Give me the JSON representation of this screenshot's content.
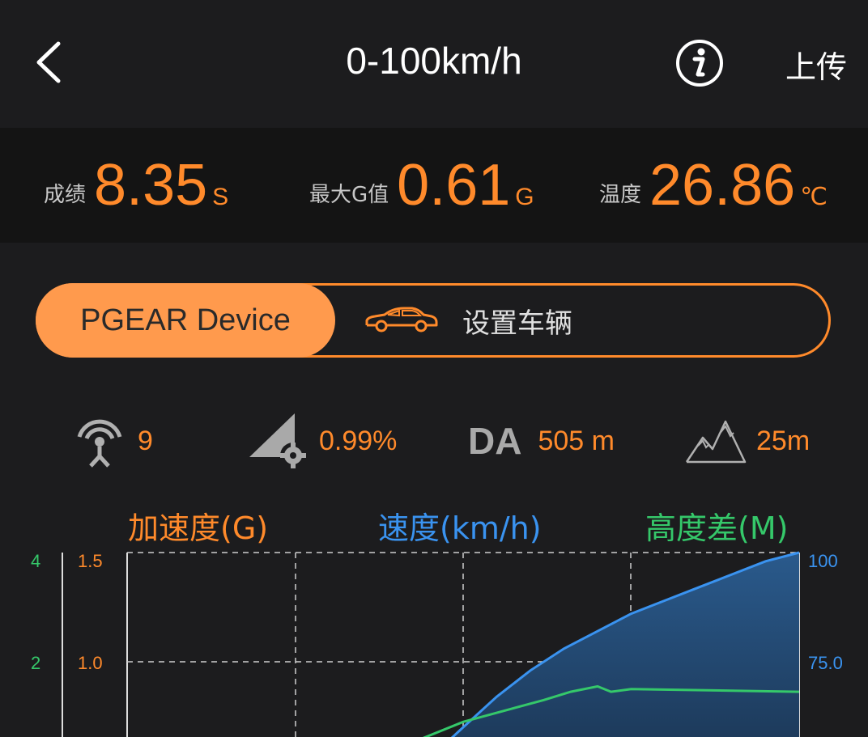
{
  "header": {
    "title": "0-100km/h",
    "upload_label": "上传"
  },
  "stats": {
    "score": {
      "label": "成绩",
      "value": "8.35",
      "unit": "S"
    },
    "max_g": {
      "label": "最大G值",
      "value": "0.61",
      "unit": "G"
    },
    "temperature": {
      "label": "温度",
      "value": "26.86",
      "unit": "℃"
    }
  },
  "segment": {
    "active_label": "PGEAR Device",
    "other_label": "设置车辆"
  },
  "indicators": {
    "satellites": "9",
    "slope": "0.99%",
    "da_label": "DA",
    "da_value": "505 m",
    "altitude": "25m"
  },
  "legend": {
    "accel": "加速度(G)",
    "speed": "速度(km/h)",
    "height": "高度差(M)"
  },
  "colors": {
    "accent": "#ff8a2b",
    "speed": "#3a93f0",
    "height": "#35c86a",
    "accel": "#ff8a2b"
  },
  "chart_data": {
    "type": "line",
    "y_axes": {
      "height": {
        "ticks": [
          "4",
          "2"
        ]
      },
      "accel": {
        "ticks": [
          "1.5",
          "1.0"
        ]
      },
      "speed": {
        "ticks": [
          "100",
          "75.0"
        ]
      }
    },
    "series": [
      {
        "name": "速度(km/h)",
        "x": [
          0.43,
          0.5,
          0.55,
          0.6,
          0.65,
          0.7,
          0.75,
          0.8,
          0.85,
          0.9,
          0.95,
          1.0
        ],
        "values": [
          50,
          60,
          67,
          73,
          78,
          82,
          86,
          89,
          92,
          95,
          98,
          100
        ]
      },
      {
        "name": "高度差(M)",
        "x": [
          0.32,
          0.38,
          0.44,
          0.5,
          0.56,
          0.62,
          0.66,
          0.7,
          0.72,
          0.75,
          1.0
        ],
        "values": [
          0.0,
          0.3,
          0.6,
          0.9,
          1.1,
          1.3,
          1.45,
          1.55,
          1.45,
          1.5,
          1.45
        ]
      }
    ]
  }
}
